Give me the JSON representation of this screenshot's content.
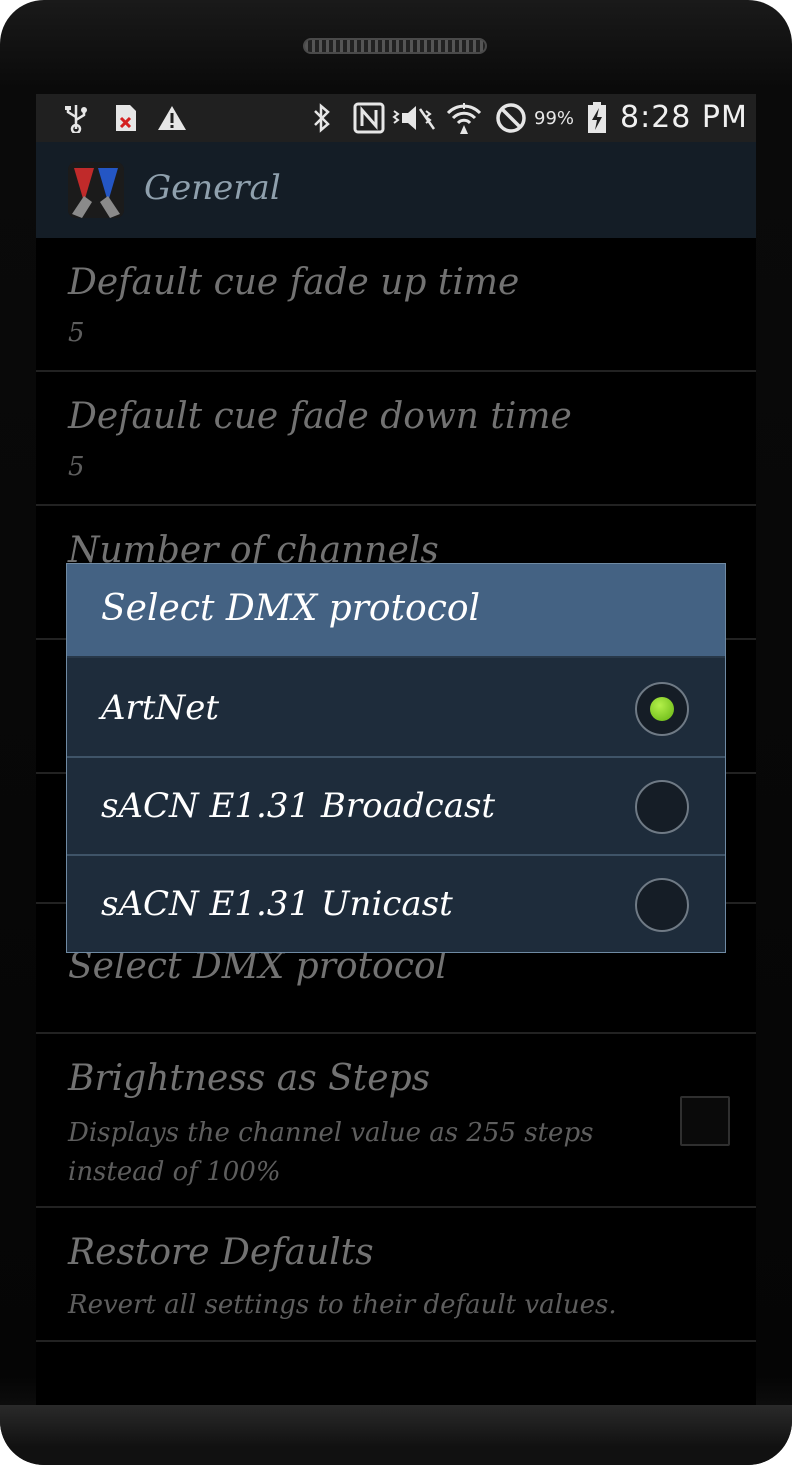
{
  "status_bar": {
    "icons": [
      "usb-icon",
      "sd-card-error-icon",
      "warning-icon",
      "bluetooth-icon",
      "nfc-icon",
      "vibrate-mute-icon",
      "wifi-icon",
      "block-icon",
      "battery-charging-icon"
    ],
    "battery_percent": "99%",
    "time": "8:28 PM"
  },
  "action_bar": {
    "title": "General"
  },
  "preferences": [
    {
      "title": "Default cue fade up time",
      "summary": "5"
    },
    {
      "title": "Default cue fade down time",
      "summary": "5"
    },
    {
      "title": "Number of channels",
      "summary": ""
    },
    {
      "title": "Select DMX protocol",
      "summary": ""
    },
    {
      "title": "Brightness as Steps",
      "summary": "Displays the channel value as 255 steps instead of 100%",
      "checked": false
    },
    {
      "title": "Restore Defaults",
      "summary": "Revert all settings to their default values."
    }
  ],
  "dialog": {
    "title": "Select DMX protocol",
    "options": [
      {
        "label": "ArtNet",
        "selected": true
      },
      {
        "label": "sACN E1.31 Broadcast",
        "selected": false
      },
      {
        "label": "sACN E1.31 Unicast",
        "selected": false
      }
    ]
  },
  "colors": {
    "dialog_header": "#446283",
    "dialog_body": "#1e2c3b",
    "radio_selected": "#7ccf1a",
    "action_bar": "#141d26"
  }
}
